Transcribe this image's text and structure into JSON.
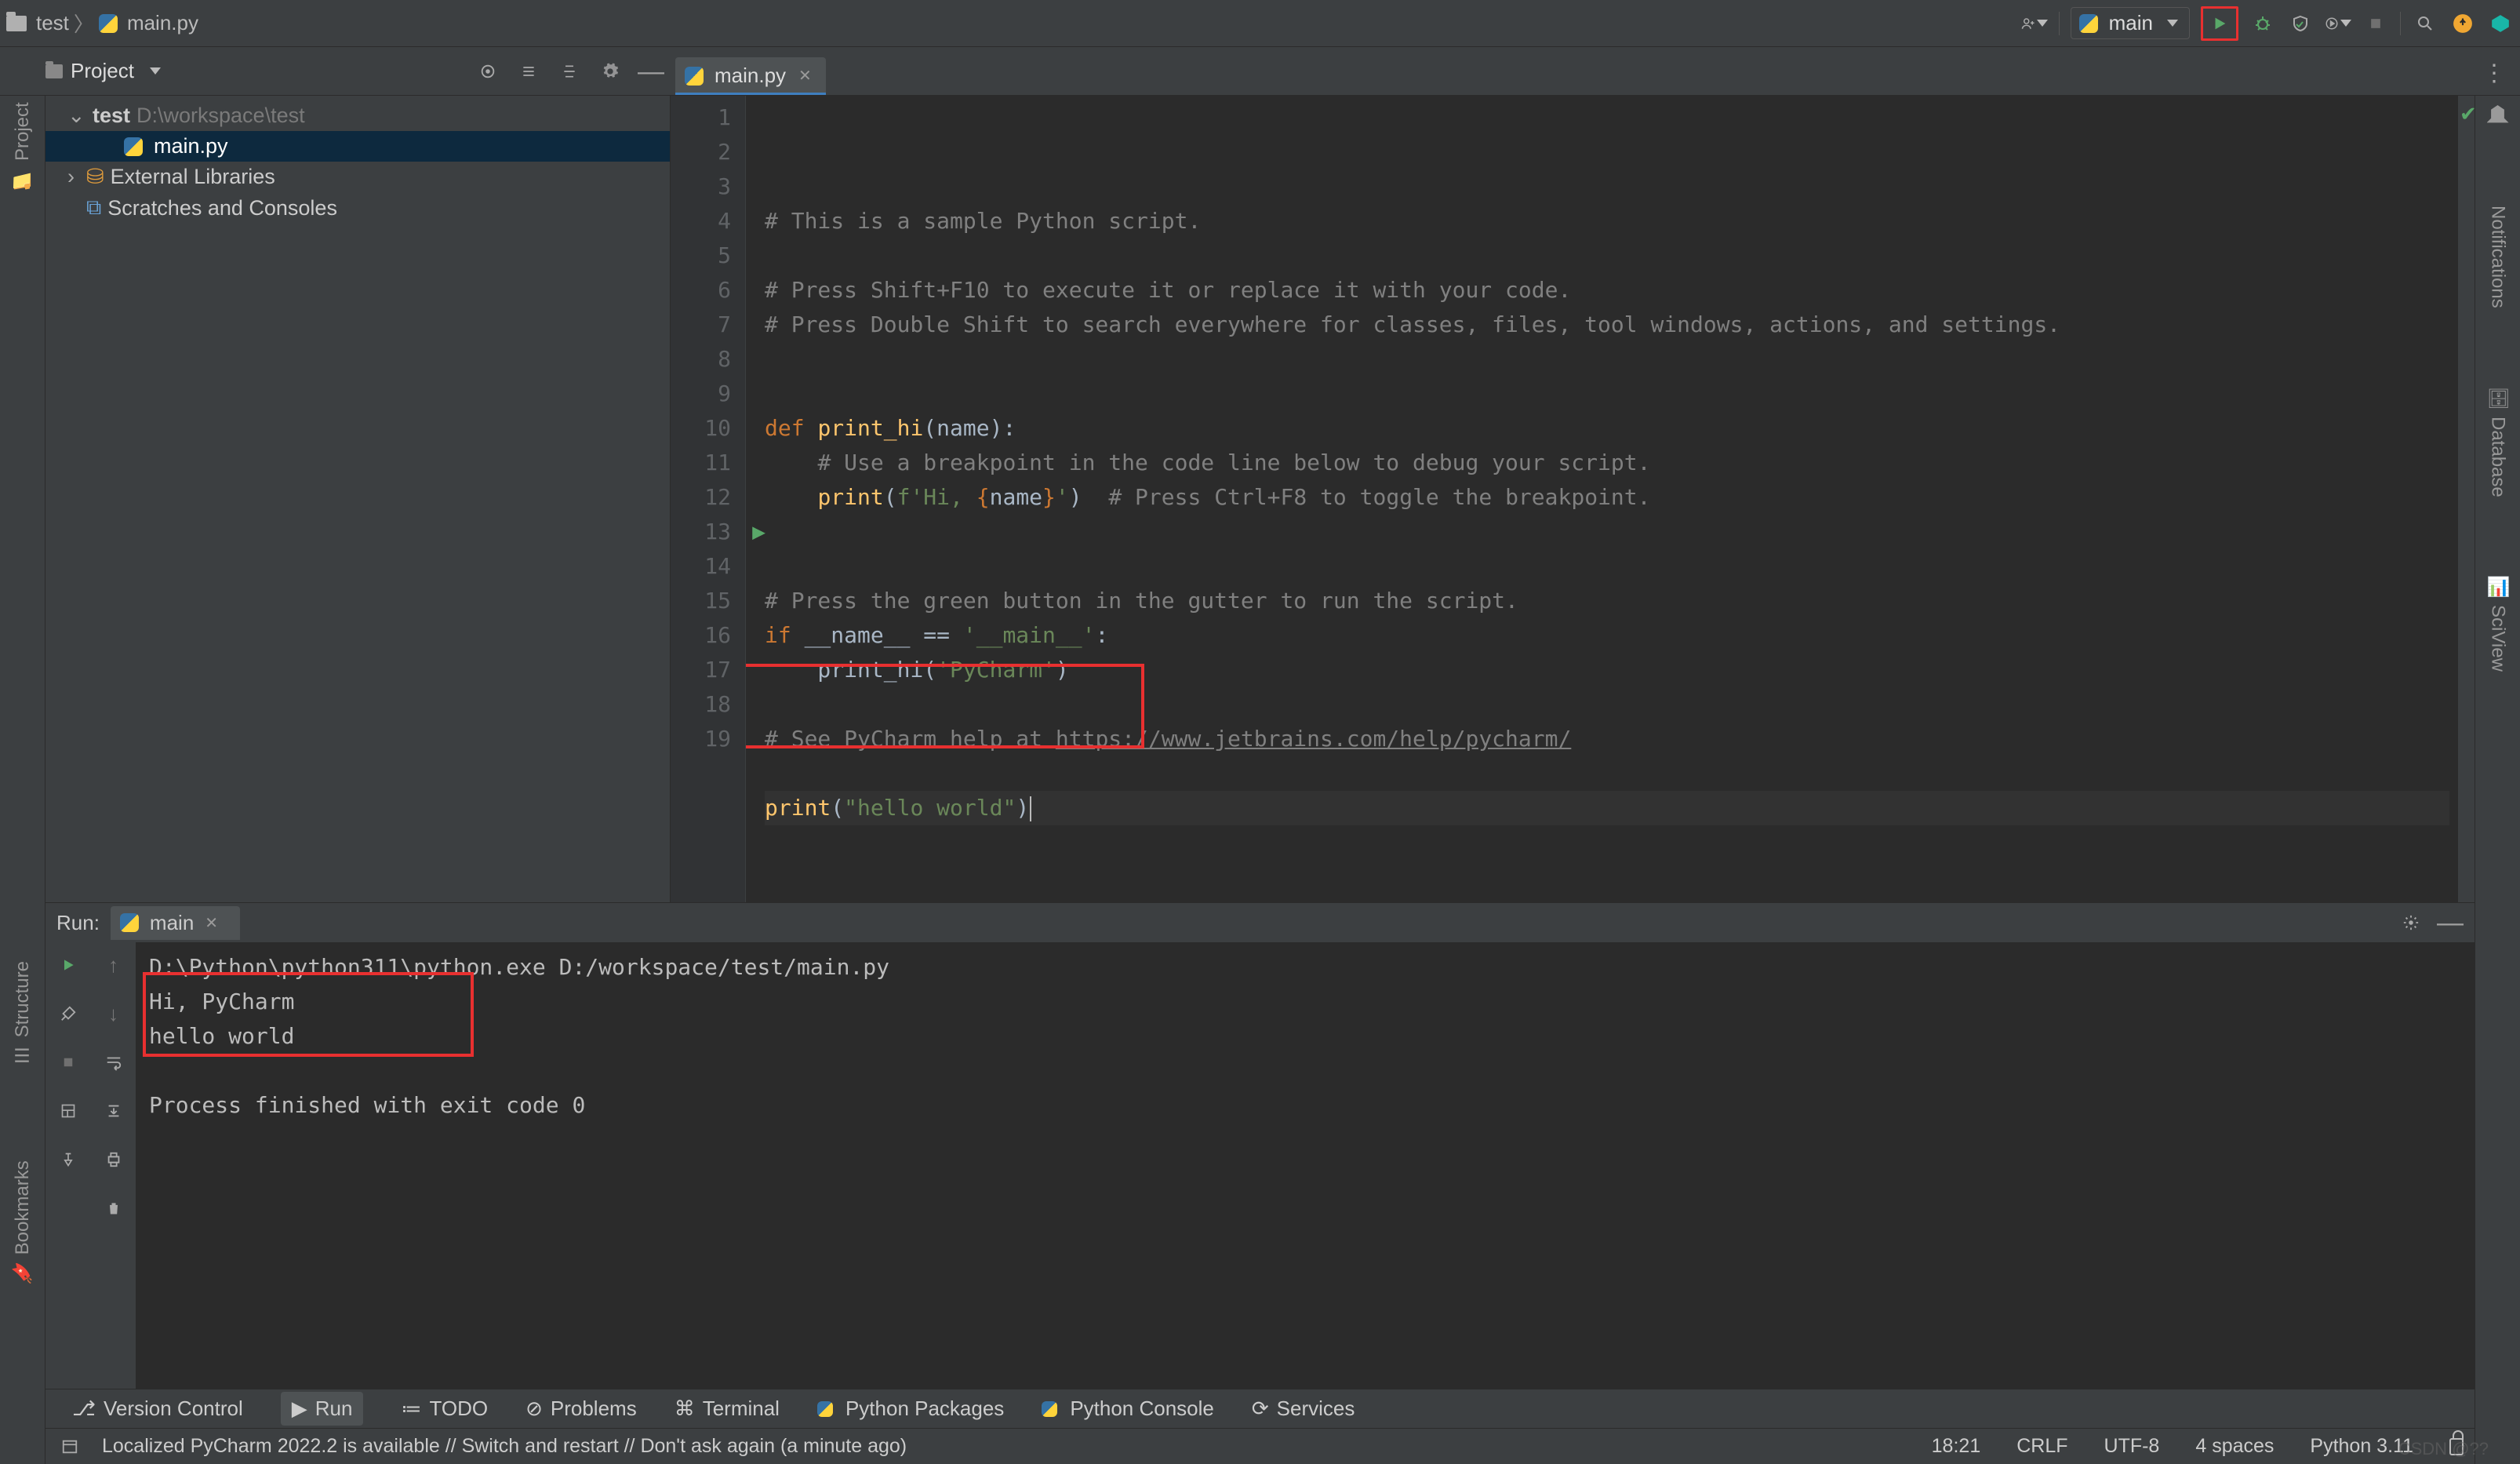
{
  "breadcrumb": {
    "root": "test",
    "file": "main.py"
  },
  "runconfig": {
    "name": "main"
  },
  "project_panel": {
    "title": "Project",
    "items": [
      {
        "kind": "root",
        "name": "test",
        "path": "D:\\workspace\\test",
        "expanded": true
      },
      {
        "kind": "file",
        "name": "main.py",
        "selected": true,
        "depth": 1
      },
      {
        "kind": "lib",
        "name": "External Libraries",
        "depth": 0
      },
      {
        "kind": "scratch",
        "name": "Scratches and Consoles",
        "depth": 0
      }
    ]
  },
  "file_tab": {
    "name": "main.py"
  },
  "left_tools": {
    "project": "Project",
    "structure": "Structure",
    "bookmarks": "Bookmarks"
  },
  "right_tools": {
    "notifications": "Notifications",
    "database": "Database",
    "sciview": "SciView"
  },
  "editor": {
    "lines": [
      {
        "n": 1,
        "segs": [
          {
            "t": "# This is a sample Python script.",
            "c": "cm"
          }
        ]
      },
      {
        "n": 2,
        "segs": []
      },
      {
        "n": 3,
        "segs": [
          {
            "t": "# Press Shift+F10 to execute it or replace it with your code.",
            "c": "cm"
          }
        ]
      },
      {
        "n": 4,
        "segs": [
          {
            "t": "# Press Double Shift to search everywhere for classes, files, tool windows, actions, and settings.",
            "c": "cm"
          }
        ]
      },
      {
        "n": 5,
        "segs": []
      },
      {
        "n": 6,
        "segs": []
      },
      {
        "n": 7,
        "segs": [
          {
            "t": "def ",
            "c": "kw"
          },
          {
            "t": "print_hi",
            "c": "fn"
          },
          {
            "t": "(name):",
            "c": ""
          }
        ]
      },
      {
        "n": 8,
        "segs": [
          {
            "t": "    ",
            "c": ""
          },
          {
            "t": "# Use a breakpoint in the code line below to debug your script.",
            "c": "cm"
          }
        ]
      },
      {
        "n": 9,
        "segs": [
          {
            "t": "    ",
            "c": ""
          },
          {
            "t": "print",
            "c": "fn"
          },
          {
            "t": "(",
            "c": ""
          },
          {
            "t": "f'Hi, ",
            "c": "str"
          },
          {
            "t": "{",
            "c": "kw"
          },
          {
            "t": "name",
            "c": ""
          },
          {
            "t": "}",
            "c": "kw"
          },
          {
            "t": "'",
            "c": "str"
          },
          {
            "t": ")  ",
            "c": ""
          },
          {
            "t": "# Press Ctrl+F8 to toggle the breakpoint.",
            "c": "cm"
          }
        ]
      },
      {
        "n": 10,
        "segs": []
      },
      {
        "n": 11,
        "segs": []
      },
      {
        "n": 12,
        "segs": [
          {
            "t": "# Press the green button in the gutter to run the script.",
            "c": "cm"
          }
        ]
      },
      {
        "n": 13,
        "run": true,
        "segs": [
          {
            "t": "if ",
            "c": "kw"
          },
          {
            "t": "__name__ == ",
            "c": ""
          },
          {
            "t": "'__main__'",
            "c": "str"
          },
          {
            "t": ":",
            "c": ""
          }
        ]
      },
      {
        "n": 14,
        "segs": [
          {
            "t": "    print_hi(",
            "c": ""
          },
          {
            "t": "'PyCharm'",
            "c": "str"
          },
          {
            "t": ")",
            "c": ""
          }
        ]
      },
      {
        "n": 15,
        "segs": []
      },
      {
        "n": 16,
        "segs": [
          {
            "t": "# See PyCharm help at ",
            "c": "cm"
          },
          {
            "t": "https://www.jetbrains.com/help/pycharm/",
            "c": "lnk"
          }
        ]
      },
      {
        "n": 17,
        "segs": []
      },
      {
        "n": 18,
        "caret": true,
        "segs": [
          {
            "t": "print",
            "c": "fn"
          },
          {
            "t": "(",
            "c": ""
          },
          {
            "t": "\"hello world\"",
            "c": "str"
          },
          {
            "t": ")",
            "c": ""
          }
        ]
      },
      {
        "n": 19,
        "segs": []
      }
    ]
  },
  "run_panel": {
    "title": "Run:",
    "tab": "main",
    "lines": [
      "D:\\Python\\python311\\python.exe D:/workspace/test/main.py",
      "Hi, PyCharm",
      "hello world",
      "",
      "Process finished with exit code 0"
    ]
  },
  "bottom_tabs": {
    "version": "Version Control",
    "run": "Run",
    "todo": "TODO",
    "problems": "Problems",
    "terminal": "Terminal",
    "pypkg": "Python Packages",
    "pyconsole": "Python Console",
    "services": "Services"
  },
  "status": {
    "msg": "Localized PyCharm 2022.2 is available // Switch and restart // Don't ask again (a minute ago)",
    "pos": "18:21",
    "sep": "CRLF",
    "enc": "UTF-8",
    "indent": "4 spaces",
    "python": "Python 3.11"
  },
  "watermark": "CSDN @??"
}
